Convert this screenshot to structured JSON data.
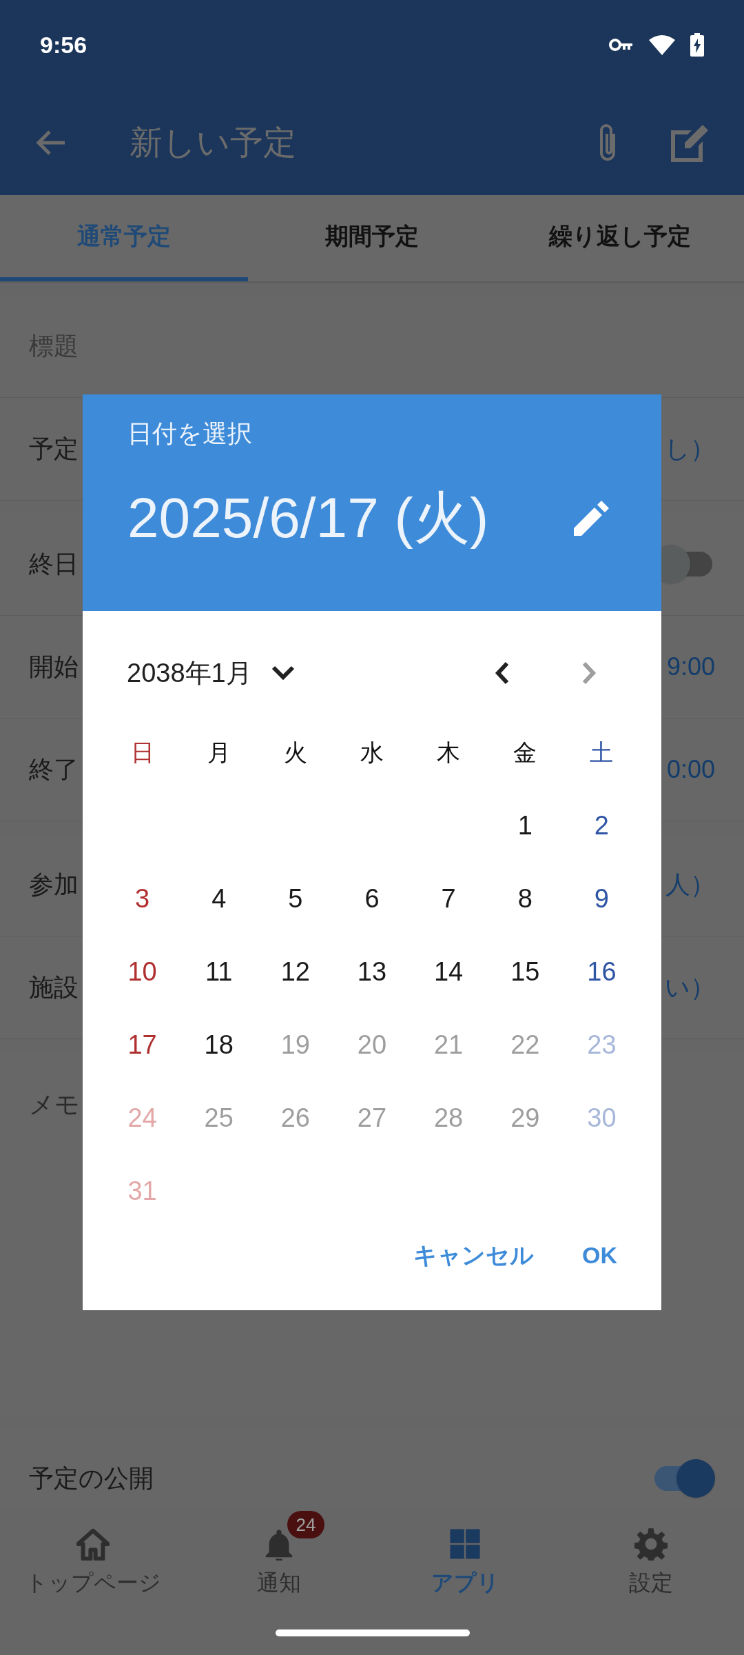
{
  "status_bar": {
    "time": "9:56"
  },
  "app_bar": {
    "title": "新しい予定"
  },
  "tabs": [
    {
      "label": "通常予定",
      "selected": true
    },
    {
      "label": "期間予定",
      "selected": false
    },
    {
      "label": "繰り返し予定",
      "selected": false
    }
  ],
  "form": {
    "groups": [
      {
        "rows": [
          {
            "kind": "placeholder",
            "label": "標題"
          },
          {
            "kind": "value",
            "label": "予定",
            "value": "し）"
          }
        ]
      },
      {
        "rows": [
          {
            "kind": "switch",
            "label": "終日",
            "on": false
          },
          {
            "kind": "value",
            "label": "開始",
            "value": "9:00"
          },
          {
            "kind": "value",
            "label": "終了",
            "value": "0:00"
          }
        ]
      },
      {
        "rows": [
          {
            "kind": "value",
            "label": "参加",
            "value": "人）"
          },
          {
            "kind": "value",
            "label": "施設",
            "value": "い）"
          }
        ]
      },
      {
        "rows": [
          {
            "kind": "memo",
            "label": "メモ"
          }
        ]
      },
      {
        "rows": [
          {
            "kind": "switch",
            "label": "予定の公開",
            "on": true
          }
        ]
      }
    ]
  },
  "date_dialog": {
    "heading": "日付を選択",
    "selected_date": "2025/6/17 (火)",
    "month_label": "2038年1月",
    "prev_disabled": false,
    "next_disabled": true,
    "weekdays": [
      "日",
      "月",
      "火",
      "水",
      "木",
      "金",
      "土"
    ],
    "weeks": [
      {
        "days": [
          {
            "label": "1",
            "disabled": false
          },
          {
            "label": "2",
            "disabled": false
          }
        ]
      },
      {
        "days": [
          {
            "label": "3",
            "disabled": false
          },
          {
            "label": "4",
            "disabled": false
          },
          {
            "label": "5",
            "disabled": false
          },
          {
            "label": "6",
            "disabled": false
          },
          {
            "label": "7",
            "disabled": false
          },
          {
            "label": "8",
            "disabled": false
          },
          {
            "label": "9",
            "disabled": false
          }
        ]
      },
      {
        "days": [
          {
            "label": "10",
            "disabled": false
          },
          {
            "label": "11",
            "disabled": false
          },
          {
            "label": "12",
            "disabled": false
          },
          {
            "label": "13",
            "disabled": false
          },
          {
            "label": "14",
            "disabled": false
          },
          {
            "label": "15",
            "disabled": false
          },
          {
            "label": "16",
            "disabled": false
          }
        ]
      },
      {
        "days": [
          {
            "label": "17",
            "disabled": false
          },
          {
            "label": "18",
            "disabled": false
          },
          {
            "label": "19",
            "disabled": true
          },
          {
            "label": "20",
            "disabled": true
          },
          {
            "label": "21",
            "disabled": true
          },
          {
            "label": "22",
            "disabled": true
          },
          {
            "label": "23",
            "disabled": true
          }
        ]
      },
      {
        "days": [
          {
            "label": "24",
            "disabled": true
          },
          {
            "label": "25",
            "disabled": true
          },
          {
            "label": "26",
            "disabled": true
          },
          {
            "label": "27",
            "disabled": true
          },
          {
            "label": "28",
            "disabled": true
          },
          {
            "label": "29",
            "disabled": true
          },
          {
            "label": "30",
            "disabled": true
          }
        ]
      },
      {
        "days": [
          {
            "label": "31",
            "disabled": true
          }
        ]
      }
    ],
    "buttons": [
      "キャンセル",
      "OK"
    ]
  },
  "bottom_nav": [
    {
      "kind": "home",
      "label": "トップページ",
      "selected": false
    },
    {
      "kind": "bell",
      "label": "通知",
      "selected": false,
      "badge": "24"
    },
    {
      "kind": "grid",
      "label": "アプリ",
      "selected": true
    },
    {
      "kind": "gear",
      "label": "設定",
      "selected": false
    }
  ]
}
